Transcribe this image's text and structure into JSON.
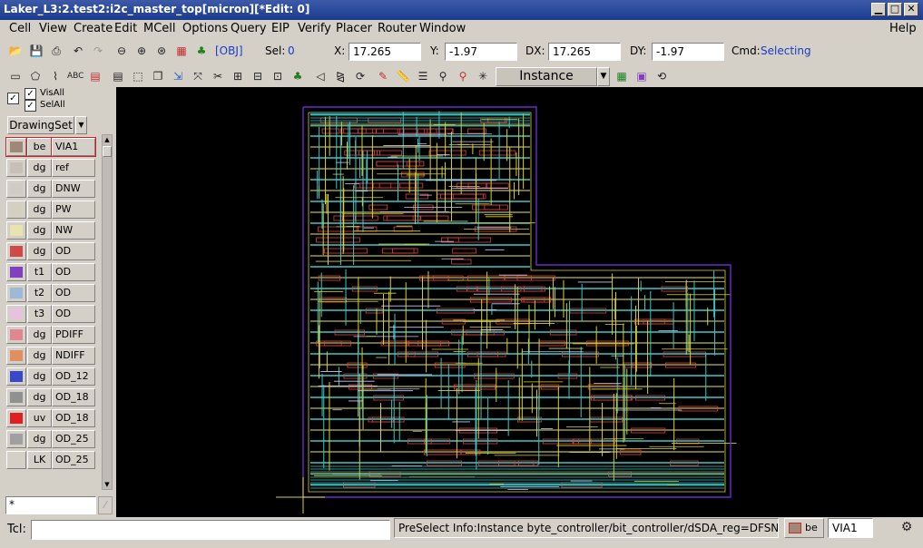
{
  "window": {
    "title": "Laker_L3:2.test2:i2c_master_top[micron][*Edit: 0]",
    "minimize_glyph": "▁",
    "maximize_glyph": "□",
    "close_glyph": "✕"
  },
  "menu": [
    "Cell",
    "View",
    "Create",
    "Edit",
    "MCell",
    "Options",
    "Query",
    "EIP",
    "Verify",
    "Placer",
    "Router",
    "Window",
    "Help"
  ],
  "toolbar": {
    "obj_label": "[OBJ]",
    "sel_label": "Sel:",
    "sel_value": "0",
    "x_label": "X:",
    "x_value": "17.265",
    "y_label": "Y:",
    "y_value": "-1.97",
    "dx_label": "DX:",
    "dx_value": "17.265",
    "dy_label": "DY:",
    "dy_value": "-1.97",
    "cmd_label": "Cmd:",
    "cmd_value": "Selecting",
    "mode_dropdown": "Instance"
  },
  "layer_panel": {
    "visall_label": "VisAll",
    "selall_label": "SelAll",
    "drawingset_label": "DrawingSet",
    "search_value": "*",
    "layers": [
      {
        "type": "be",
        "name": "VIA1",
        "color": "#a08878",
        "selected": true
      },
      {
        "type": "dg",
        "name": "ref",
        "color": "#c8c0b8",
        "selected": false
      },
      {
        "type": "dg",
        "name": "DNW",
        "color": "#d0ccc4",
        "selected": false
      },
      {
        "type": "dg",
        "name": "PW",
        "color": "#d4d0c0",
        "selected": false
      },
      {
        "type": "dg",
        "name": "NW",
        "color": "#e8e4b0",
        "selected": false
      },
      {
        "type": "dg",
        "name": "OD",
        "color": "#d04848",
        "selected": false
      },
      {
        "type": "t1",
        "name": "OD",
        "color": "#8040c0",
        "selected": false
      },
      {
        "type": "t2",
        "name": "OD",
        "color": "#a0b8d8",
        "selected": false
      },
      {
        "type": "t3",
        "name": "OD",
        "color": "#e8c0e0",
        "selected": false
      },
      {
        "type": "dg",
        "name": "PDIFF",
        "color": "#e08890",
        "selected": false
      },
      {
        "type": "dg",
        "name": "NDIFF",
        "color": "#e09060",
        "selected": false
      },
      {
        "type": "dg",
        "name": "OD_12",
        "color": "#3848c8",
        "selected": false
      },
      {
        "type": "dg",
        "name": "OD_18",
        "color": "#909090",
        "selected": false
      },
      {
        "type": "uv",
        "name": "OD_18",
        "color": "#e02020",
        "selected": false
      },
      {
        "type": "dg",
        "name": "OD_25",
        "color": "#a0a0a0",
        "selected": false
      },
      {
        "type": "LK",
        "name": "OD_25",
        "color": "#d4d0c8",
        "selected": false
      }
    ]
  },
  "status": {
    "tcl_label": "Tcl:",
    "tcl_value": "",
    "preselect_info": "PreSelect Info:Instance byte_controller/bit_controller/dSDA_reg=DFSNQD",
    "current_layer_type": "be",
    "current_layer_name": "VIA1"
  },
  "colors": {
    "canvas": "#000000",
    "boundary": "#6a2cc8",
    "metal1": "#3cc8c8",
    "metal2": "#d8d030",
    "cells": "#e04040",
    "crosshair": "#d8d030"
  }
}
